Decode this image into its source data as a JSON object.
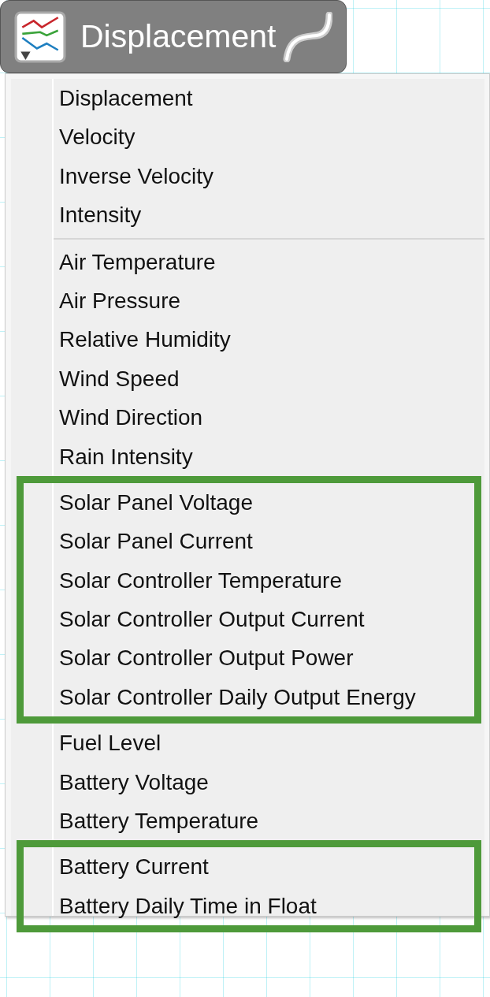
{
  "header": {
    "title": "Displacement"
  },
  "menu": {
    "blocks": [
      {
        "kind": "items",
        "highlighted": false,
        "items": [
          "Displacement",
          "Velocity",
          "Inverse Velocity",
          "Intensity"
        ]
      },
      {
        "kind": "separator"
      },
      {
        "kind": "items",
        "highlighted": false,
        "items": [
          "Air Temperature",
          "Air Pressure",
          "Relative Humidity",
          "Wind Speed",
          "Wind Direction",
          "Rain Intensity"
        ]
      },
      {
        "kind": "items",
        "highlighted": true,
        "items": [
          "Solar Panel Voltage",
          "Solar Panel Current",
          "Solar Controller Temperature",
          "Solar Controller Output Current",
          "Solar Controller Output Power",
          "Solar Controller Daily Output Energy"
        ]
      },
      {
        "kind": "items",
        "highlighted": false,
        "items": [
          "Fuel Level",
          "Battery Voltage",
          "Battery Temperature"
        ]
      },
      {
        "kind": "items",
        "highlighted": true,
        "items": [
          "Battery Current",
          "Battery Daily Time in Float"
        ]
      }
    ]
  }
}
